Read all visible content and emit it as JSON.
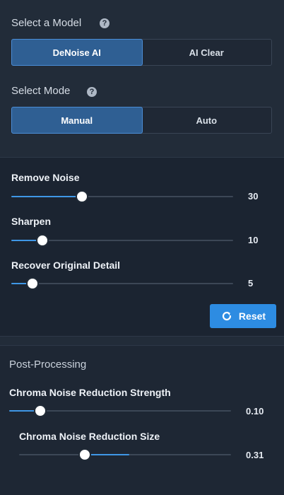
{
  "model": {
    "label": "Select a Model",
    "help": "?",
    "options": [
      "DeNoise AI",
      "AI Clear"
    ],
    "selected": "DeNoise AI"
  },
  "mode": {
    "label": "Select Mode",
    "help": "?",
    "options": [
      "Manual",
      "Auto"
    ],
    "selected": "Manual"
  },
  "sliders": [
    {
      "label": "Remove Noise",
      "value": "30",
      "fraction": 0.32
    },
    {
      "label": "Sharpen",
      "value": "10",
      "fraction": 0.14
    },
    {
      "label": "Recover Original Detail",
      "value": "5",
      "fraction": 0.095
    }
  ],
  "reset_label": "Reset",
  "post": {
    "title": "Post-Processing",
    "sliders": [
      {
        "label": "Chroma Noise Reduction Strength",
        "value": "0.10",
        "fraction": 0.14
      },
      {
        "label": "Chroma Noise Reduction Size",
        "value": "0.31",
        "fraction": 0.31
      }
    ]
  },
  "colors": {
    "accent": "#3f97e6",
    "button": "#2d8ce2",
    "active_segment": "#2f5f93"
  }
}
